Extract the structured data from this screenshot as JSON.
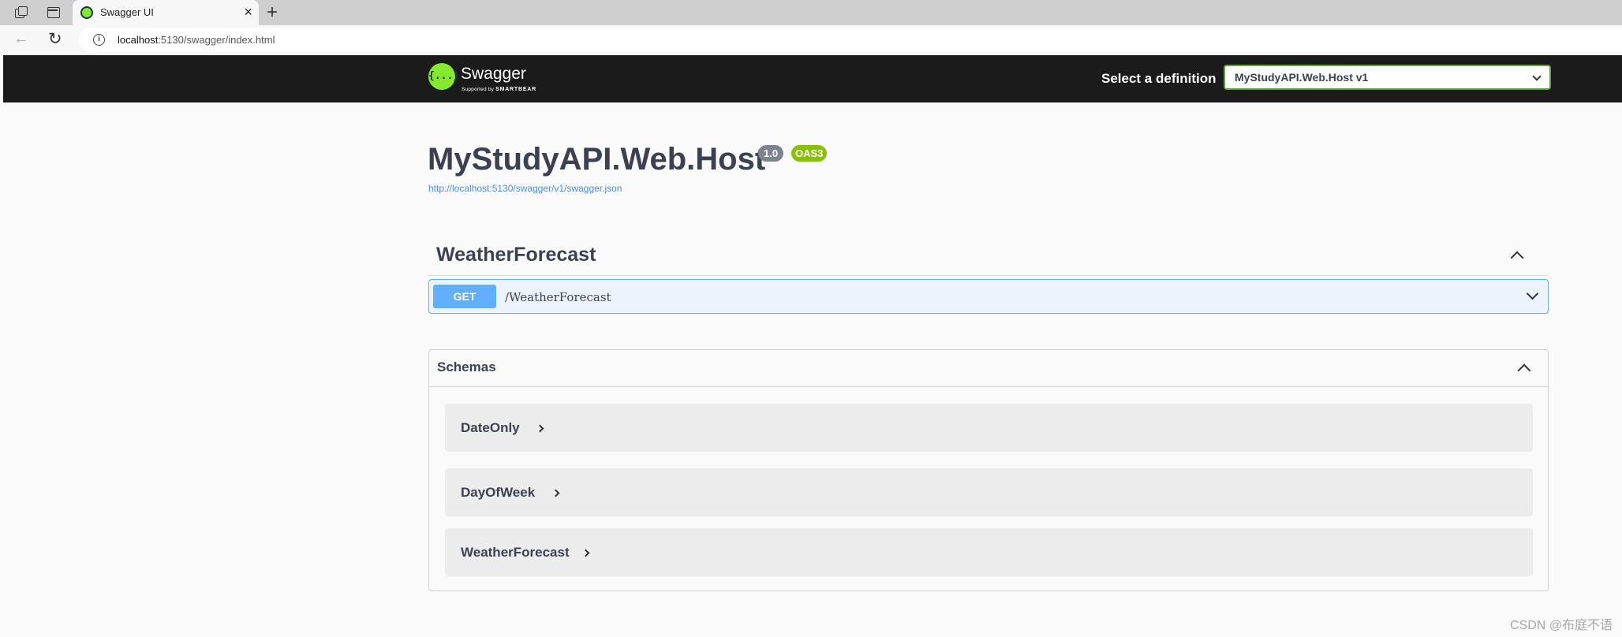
{
  "browser": {
    "tab_title": "Swagger UI",
    "url_host": "localhost",
    "url_path": ":5130/swagger/index.html"
  },
  "topbar": {
    "logo_text": "Swagger",
    "logo_subtext": "Supported by",
    "logo_brand": "SMARTBEAR",
    "logo_glyph": "{...}",
    "definition_label": "Select a definition",
    "definition_value": "MyStudyAPI.Web.Host v1"
  },
  "info": {
    "title": "MyStudyAPI.Web.Host",
    "version": "1.0",
    "oas": "OAS3",
    "spec_url": "http://localhost:5130/swagger/v1/swagger.json"
  },
  "operations": {
    "tag": "WeatherForecast",
    "items": [
      {
        "method": "GET",
        "path": "/WeatherForecast"
      }
    ]
  },
  "schemas": {
    "title": "Schemas",
    "items": [
      {
        "name": "DateOnly"
      },
      {
        "name": "DayOfWeek"
      },
      {
        "name": "WeatherForecast"
      }
    ]
  },
  "watermark": "CSDN @布庭不语",
  "colors": {
    "get_method": "#61affe",
    "oas_badge": "#89bf04",
    "brand_green": "#85ea2d",
    "topbar_bg": "#1b1b1b"
  }
}
